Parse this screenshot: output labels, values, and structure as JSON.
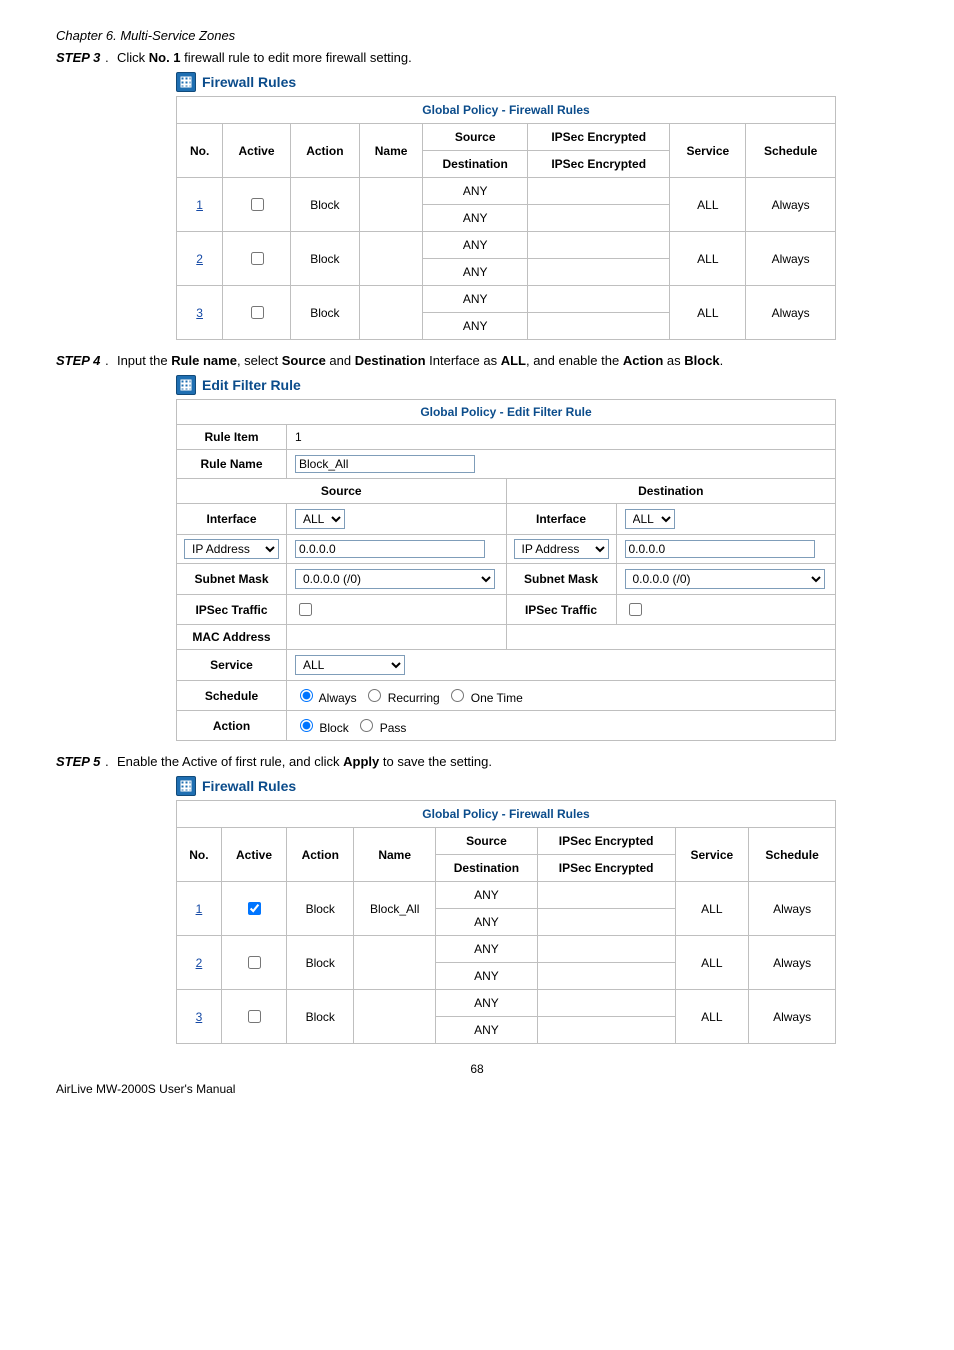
{
  "chapter": "Chapter 6. Multi-Service Zones",
  "step3": {
    "label": "STEP 3",
    "punct": "﹒",
    "pre": "Click ",
    "bold": "No. 1",
    "post": " firewall rule to edit more firewall setting."
  },
  "step4": {
    "label": "STEP 4",
    "punct": "﹒",
    "t0": "Input the ",
    "b0": "Rule name",
    "t1": ", select ",
    "b1": "Source",
    "t2": " and ",
    "b2": "Destination",
    "t3": " Interface as ",
    "b3": "ALL",
    "t4": ", and enable the ",
    "b4": "Action",
    "t5": " as ",
    "b5": "Block",
    "t6": "."
  },
  "step5": {
    "label": "STEP 5",
    "punct": "﹒",
    "pre": "Enable the Active of first rule, and click ",
    "bold": "Apply",
    "post": " to save the setting."
  },
  "sections": {
    "firewall_rules": "Firewall Rules",
    "edit_filter_rule": "Edit Filter Rule"
  },
  "fw_table": {
    "caption": "Global Policy - Firewall Rules",
    "headers": {
      "no": "No.",
      "active": "Active",
      "action": "Action",
      "name": "Name",
      "source": "Source",
      "destination": "Destination",
      "ipsec_enc": "IPSec Encrypted",
      "service": "Service",
      "schedule": "Schedule"
    },
    "rows1": [
      {
        "no": "1",
        "checked": false,
        "action": "Block",
        "name": "",
        "source": "ANY",
        "dest": "ANY",
        "ipsec_s": "",
        "ipsec_d": "",
        "service": "ALL",
        "schedule": "Always"
      },
      {
        "no": "2",
        "checked": false,
        "action": "Block",
        "name": "",
        "source": "ANY",
        "dest": "ANY",
        "ipsec_s": "",
        "ipsec_d": "",
        "service": "ALL",
        "schedule": "Always"
      },
      {
        "no": "3",
        "checked": false,
        "action": "Block",
        "name": "",
        "source": "ANY",
        "dest": "ANY",
        "ipsec_s": "",
        "ipsec_d": "",
        "service": "ALL",
        "schedule": "Always"
      }
    ],
    "rows2": [
      {
        "no": "1",
        "checked": true,
        "action": "Block",
        "name": "Block_All",
        "source": "ANY",
        "dest": "ANY",
        "ipsec_s": "",
        "ipsec_d": "",
        "service": "ALL",
        "schedule": "Always"
      },
      {
        "no": "2",
        "checked": false,
        "action": "Block",
        "name": "",
        "source": "ANY",
        "dest": "ANY",
        "ipsec_s": "",
        "ipsec_d": "",
        "service": "ALL",
        "schedule": "Always"
      },
      {
        "no": "3",
        "checked": false,
        "action": "Block",
        "name": "",
        "source": "ANY",
        "dest": "ANY",
        "ipsec_s": "",
        "ipsec_d": "",
        "service": "ALL",
        "schedule": "Always"
      }
    ]
  },
  "edit_table": {
    "caption": "Global Policy - Edit Filter Rule",
    "labels": {
      "rule_item": "Rule Item",
      "rule_name": "Rule Name",
      "source": "Source",
      "destination": "Destination",
      "interface": "Interface",
      "ip_address": "IP Address",
      "subnet_mask": "Subnet Mask",
      "ipsec_traffic": "IPSec Traffic",
      "mac_address": "MAC Address",
      "service": "Service",
      "schedule": "Schedule",
      "action": "Action"
    },
    "values": {
      "rule_item": "1",
      "rule_name": "Block_All",
      "src_interface": "ALL",
      "src_ip_type": "IP Address",
      "src_ip": "0.0.0.0",
      "src_mask": "0.0.0.0 (/0)",
      "src_ipsec": false,
      "dst_interface": "ALL",
      "dst_ip_type": "IP Address",
      "dst_ip": "0.0.0.0",
      "dst_mask": "0.0.0.0 (/0)",
      "dst_ipsec": false,
      "mac_address": "",
      "service": "ALL",
      "schedule_options": {
        "always": "Always",
        "recurring": "Recurring",
        "onetime": "One Time"
      },
      "action_options": {
        "block": "Block",
        "pass": "Pass"
      }
    }
  },
  "page_number": "68",
  "footer": "AirLive MW-2000S User's Manual"
}
